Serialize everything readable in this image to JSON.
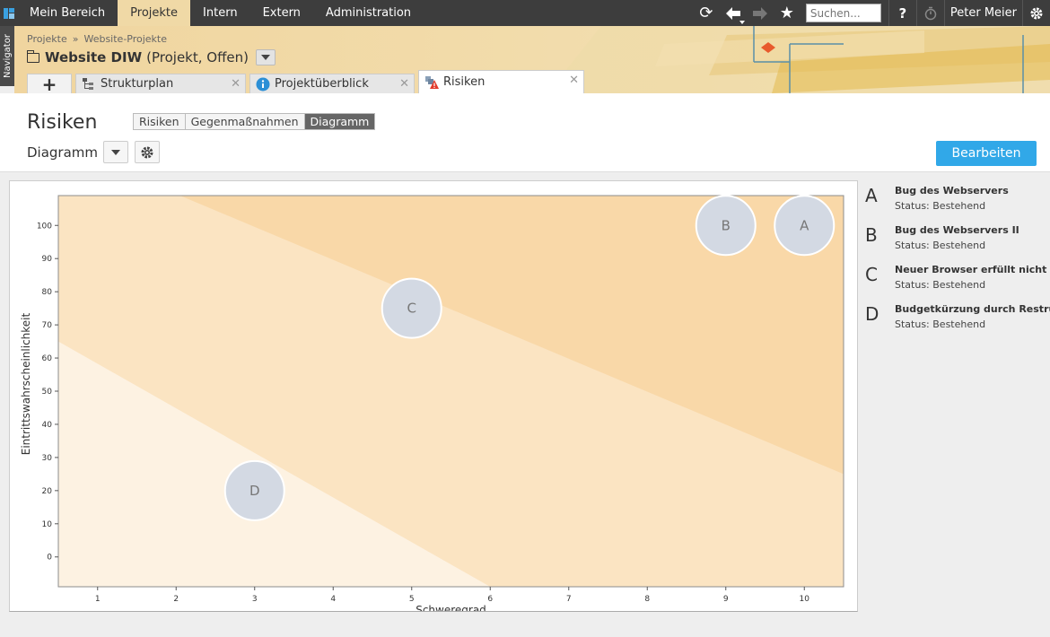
{
  "topnav": {
    "items": [
      {
        "label": "Mein Bereich",
        "active": false
      },
      {
        "label": "Projekte",
        "active": true
      },
      {
        "label": "Intern",
        "active": false
      },
      {
        "label": "Extern",
        "active": false
      },
      {
        "label": "Administration",
        "active": false
      }
    ],
    "search_placeholder": "Suchen...",
    "help_label": "?",
    "user_name": "Peter Meier",
    "icons": [
      "refresh-icon",
      "back-arrow-icon",
      "forward-arrow-icon",
      "star-icon",
      "help-icon",
      "timer-icon",
      "gear-icon"
    ]
  },
  "navigator_label": "Navigator",
  "header": {
    "breadcrumb": [
      "Projekte",
      "Website-Projekte"
    ],
    "breadcrumb_separator": "»",
    "project_name": "Website DIW",
    "project_meta": "(Projekt, Offen)"
  },
  "tabs": [
    {
      "label": "Strukturplan",
      "icon": "tree-icon",
      "active": false
    },
    {
      "label": "Projektüberblick",
      "icon": "info-icon",
      "active": false
    },
    {
      "label": "Risiken",
      "icon": "warning-icon",
      "active": true
    }
  ],
  "tab_add_label": "+",
  "tab_close_label": "✕",
  "page": {
    "title": "Risiken",
    "segments": [
      {
        "label": "Risiken",
        "active": false
      },
      {
        "label": "Gegenmaßnahmen",
        "active": false
      },
      {
        "label": "Diagramm",
        "active": true
      }
    ],
    "subtitle": "Diagramm",
    "edit_button": "Bearbeiten"
  },
  "chart_data": {
    "type": "scatter",
    "xlabel": "Schweregrad",
    "ylabel": "Eintrittswahrscheinlichkeit",
    "xlim": [
      0.5,
      10.5
    ],
    "ylim": [
      -9,
      109
    ],
    "x_ticks": [
      1,
      2,
      3,
      4,
      5,
      6,
      7,
      8,
      9,
      10
    ],
    "y_ticks": [
      0,
      10,
      20,
      30,
      40,
      50,
      60,
      70,
      80,
      90,
      100
    ],
    "zones": [
      {
        "name": "low",
        "color": "#fdf2e2"
      },
      {
        "name": "medium",
        "color": "#fbe4c2"
      },
      {
        "name": "high",
        "color": "#f9d8a8"
      }
    ],
    "bubble_color": "#d3d9e3",
    "points": [
      {
        "label": "A",
        "x": 10,
        "y": 100
      },
      {
        "label": "B",
        "x": 9,
        "y": 100
      },
      {
        "label": "C",
        "x": 5,
        "y": 75
      },
      {
        "label": "D",
        "x": 3,
        "y": 20
      }
    ]
  },
  "legend": [
    {
      "letter": "A",
      "name": "Bug des Webservers",
      "status": "Status: Bestehend"
    },
    {
      "letter": "B",
      "name": "Bug des Webservers II",
      "status": "Status: Bestehend"
    },
    {
      "letter": "C",
      "name": "Neuer Browser erfüllt nicht die",
      "status": "Status: Bestehend"
    },
    {
      "letter": "D",
      "name": "Budgetkürzung durch Restrukt",
      "status": "Status: Bestehend"
    }
  ],
  "colors": {
    "accent": "#31a8e8",
    "topbar": "#3d3d3d",
    "active_nav": "#f0d9a6"
  }
}
